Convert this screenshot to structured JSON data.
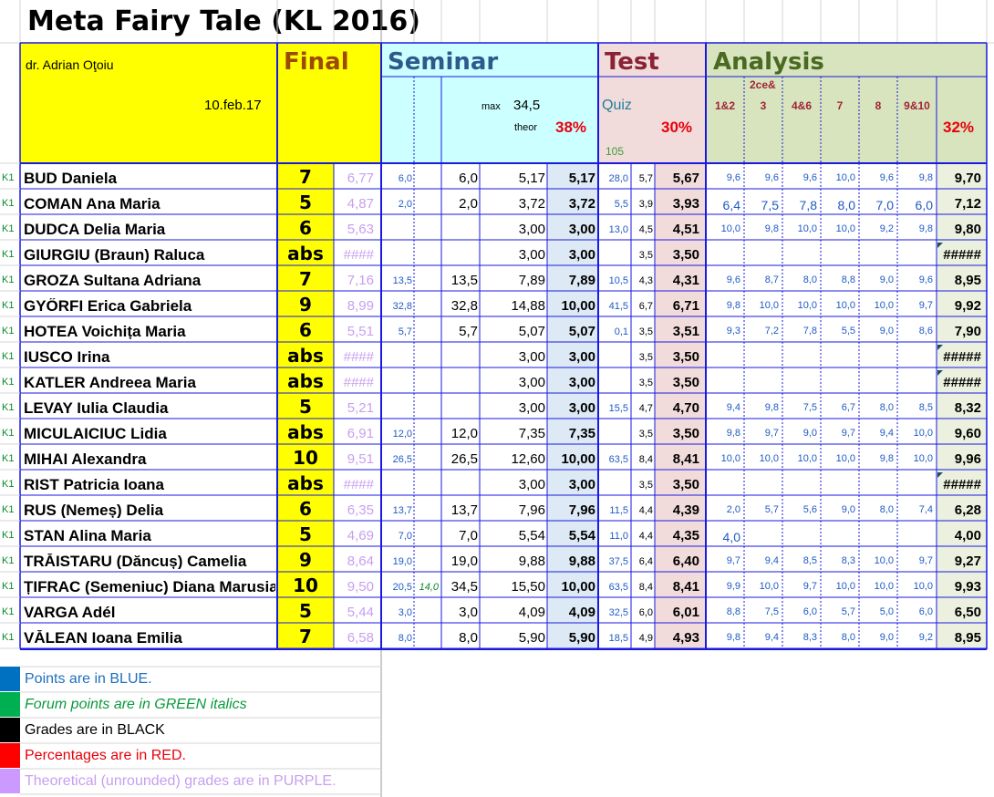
{
  "title": "Meta Fairy Tale (KL 2016)",
  "teacher": "dr. Adrian Oţoiu",
  "date": "10.feb.17",
  "sections": {
    "final": "Final",
    "seminar": "Seminar",
    "test": "Test",
    "analysis": "Analysis"
  },
  "seminar_header": {
    "max_label": "max",
    "max_value": "34,5",
    "theor_label": "theor",
    "percent": "38%"
  },
  "test_header": {
    "label": "Quiz",
    "percent": "30%",
    "forum_count": "105"
  },
  "analysis_header": {
    "cols": [
      "1&2",
      "3",
      "4&6",
      "7",
      "8",
      "9&10"
    ],
    "col2_top": "2ce&",
    "percent": "32%"
  },
  "colors": {
    "yellow": "#ffff00",
    "seminar_bg": "#ccffff",
    "test_bg": "#f2dcdb",
    "analysis_bg": "#d7e4bd",
    "border_blue": "#1a1ae0"
  },
  "rows": [
    {
      "k": "K1",
      "name": "BUD Daniela",
      "final": "7",
      "theor": "6,77",
      "s1": "6,0",
      "s2": "",
      "s3": "6,0",
      "s4": "5,17",
      "sg": "5,17",
      "q1": "28,0",
      "q2": "5,7",
      "qg": "5,67",
      "a": [
        "9,6",
        "9,6",
        "9,6",
        "10,0",
        "9,6",
        "9,8"
      ],
      "ag": "9,70"
    },
    {
      "k": "K1",
      "name": "COMAN Ana Maria",
      "final": "5",
      "theor": "4,87",
      "s1": "2,0",
      "s2": "",
      "s3": "2,0",
      "s4": "3,72",
      "sg": "3,72",
      "q1": "5,5",
      "q2": "3,9",
      "qg": "3,93",
      "a": [
        "6,4",
        "7,5",
        "7,8",
        "8,0",
        "7,0",
        "6,0"
      ],
      "ag": "7,12"
    },
    {
      "k": "K1",
      "name": "DUDCA Delia Maria",
      "final": "6",
      "theor": "5,63",
      "s1": "",
      "s2": "",
      "s3": "",
      "s4": "3,00",
      "sg": "3,00",
      "q1": "13,0",
      "q2": "4,5",
      "qg": "4,51",
      "a": [
        "10,0",
        "9,8",
        "10,0",
        "10,0",
        "9,2",
        "9,8"
      ],
      "ag": "9,80"
    },
    {
      "k": "K1",
      "name": "GIURGIU (Braun) Raluca",
      "final": "abs",
      "theor": "####",
      "s1": "",
      "s2": "",
      "s3": "",
      "s4": "3,00",
      "sg": "3,00",
      "q1": "",
      "q2": "3,5",
      "qg": "3,50",
      "a": [
        "",
        "",
        "",
        "",
        "",
        ""
      ],
      "ag": "#####"
    },
    {
      "k": "K1",
      "name": "GROZA Sultana Adriana",
      "final": "7",
      "theor": "7,16",
      "s1": "13,5",
      "s2": "",
      "s3": "13,5",
      "s4": "7,89",
      "sg": "7,89",
      "q1": "10,5",
      "q2": "4,3",
      "qg": "4,31",
      "a": [
        "9,6",
        "8,7",
        "8,0",
        "8,8",
        "9,0",
        "9,6"
      ],
      "ag": "8,95"
    },
    {
      "k": "K1",
      "name": "GYŐRFI Erica Gabriela",
      "final": "9",
      "theor": "8,99",
      "s1": "32,8",
      "s2": "",
      "s3": "32,8",
      "s4": "14,88",
      "sg": "10,00",
      "q1": "41,5",
      "q2": "6,7",
      "qg": "6,71",
      "a": [
        "9,8",
        "10,0",
        "10,0",
        "10,0",
        "10,0",
        "9,7"
      ],
      "ag": "9,92"
    },
    {
      "k": "K1",
      "name": "HOTEA Voichița Maria",
      "final": "6",
      "theor": "5,51",
      "s1": "5,7",
      "s2": "",
      "s3": "5,7",
      "s4": "5,07",
      "sg": "5,07",
      "q1": "0,1",
      "q2": "3,5",
      "qg": "3,51",
      "a": [
        "9,3",
        "7,2",
        "7,8",
        "5,5",
        "9,0",
        "8,6"
      ],
      "ag": "7,90"
    },
    {
      "k": "K1",
      "name": "IUSCO Irina",
      "final": "abs",
      "theor": "####",
      "s1": "",
      "s2": "",
      "s3": "",
      "s4": "3,00",
      "sg": "3,00",
      "q1": "",
      "q2": "3,5",
      "qg": "3,50",
      "a": [
        "",
        "",
        "",
        "",
        "",
        ""
      ],
      "ag": "#####"
    },
    {
      "k": "K1",
      "name": "KATLER Andreea Maria",
      "final": "abs",
      "theor": "####",
      "s1": "",
      "s2": "",
      "s3": "",
      "s4": "3,00",
      "sg": "3,00",
      "q1": "",
      "q2": "3,5",
      "qg": "3,50",
      "a": [
        "",
        "",
        "",
        "",
        "",
        ""
      ],
      "ag": "#####"
    },
    {
      "k": "K1",
      "name": "LEVAY Iulia Claudia",
      "final": "5",
      "theor": "5,21",
      "s1": "",
      "s2": "",
      "s3": "",
      "s4": "3,00",
      "sg": "3,00",
      "q1": "15,5",
      "q2": "4,7",
      "qg": "4,70",
      "a": [
        "9,4",
        "9,8",
        "7,5",
        "6,7",
        "8,0",
        "8,5"
      ],
      "ag": "8,32"
    },
    {
      "k": "K1",
      "name": "MICULAICIUC Lidia",
      "final": "abs",
      "theor": "6,91",
      "s1": "12,0",
      "s2": "",
      "s3": "12,0",
      "s4": "7,35",
      "sg": "7,35",
      "q1": "",
      "q2": "3,5",
      "qg": "3,50",
      "a": [
        "9,8",
        "9,7",
        "9,0",
        "9,7",
        "9,4",
        "10,0"
      ],
      "ag": "9,60"
    },
    {
      "k": "K1",
      "name": "MIHAI Alexandra",
      "final": "10",
      "theor": "9,51",
      "s1": "26,5",
      "s2": "",
      "s3": "26,5",
      "s4": "12,60",
      "sg": "10,00",
      "q1": "63,5",
      "q2": "8,4",
      "qg": "8,41",
      "a": [
        "10,0",
        "10,0",
        "10,0",
        "10,0",
        "9,8",
        "10,0"
      ],
      "ag": "9,96"
    },
    {
      "k": "K1",
      "name": "RIST Patricia Ioana",
      "final": "abs",
      "theor": "####",
      "s1": "",
      "s2": "",
      "s3": "",
      "s4": "3,00",
      "sg": "3,00",
      "q1": "",
      "q2": "3,5",
      "qg": "3,50",
      "a": [
        "",
        "",
        "",
        "",
        "",
        ""
      ],
      "ag": "#####"
    },
    {
      "k": "K1",
      "name": "RUS (Nemeș) Delia",
      "final": "6",
      "theor": "6,35",
      "s1": "13,7",
      "s2": "",
      "s3": "13,7",
      "s4": "7,96",
      "sg": "7,96",
      "q1": "11,5",
      "q2": "4,4",
      "qg": "4,39",
      "a": [
        "2,0",
        "5,7",
        "5,6",
        "9,0",
        "8,0",
        "7,4"
      ],
      "ag": "6,28"
    },
    {
      "k": "K1",
      "name": "STAN Alina Maria",
      "final": "5",
      "theor": "4,69",
      "s1": "7,0",
      "s2": "",
      "s3": "7,0",
      "s4": "5,54",
      "sg": "5,54",
      "q1": "11,0",
      "q2": "4,4",
      "qg": "4,35",
      "a": [
        "4,0",
        "",
        "",
        "",
        "",
        ""
      ],
      "ag": "4,00"
    },
    {
      "k": "K1",
      "name": "TRĂISTARU (Dăncuș) Camelia",
      "final": "9",
      "theor": "8,64",
      "s1": "19,0",
      "s2": "",
      "s3": "19,0",
      "s4": "9,88",
      "sg": "9,88",
      "q1": "37,5",
      "q2": "6,4",
      "qg": "6,40",
      "a": [
        "9,7",
        "9,4",
        "8,5",
        "8,3",
        "10,0",
        "9,7"
      ],
      "ag": "9,27"
    },
    {
      "k": "K1",
      "name": "ȚIFRAC (Semeniuc) Diana Marusia",
      "final": "10",
      "theor": "9,50",
      "s1": "20,5",
      "s2": "14,0",
      "s3": "34,5",
      "s4": "15,50",
      "sg": "10,00",
      "q1": "63,5",
      "q2": "8,4",
      "qg": "8,41",
      "a": [
        "9,9",
        "10,0",
        "9,7",
        "10,0",
        "10,0",
        "10,0"
      ],
      "ag": "9,93"
    },
    {
      "k": "K1",
      "name": "VARGA Adél",
      "final": "5",
      "theor": "5,44",
      "s1": "3,0",
      "s2": "",
      "s3": "3,0",
      "s4": "4,09",
      "sg": "4,09",
      "q1": "32,5",
      "q2": "6,0",
      "qg": "6,01",
      "a": [
        "8,8",
        "7,5",
        "6,0",
        "5,7",
        "5,0",
        "6,0"
      ],
      "ag": "6,50"
    },
    {
      "k": "K1",
      "name": "VĂLEAN Ioana Emilia",
      "final": "7",
      "theor": "6,58",
      "s1": "8,0",
      "s2": "",
      "s3": "8,0",
      "s4": "5,90",
      "sg": "5,90",
      "q1": "18,5",
      "q2": "4,9",
      "qg": "4,93",
      "a": [
        "9,8",
        "9,4",
        "8,3",
        "8,0",
        "9,0",
        "9,2"
      ],
      "ag": "8,95"
    }
  ],
  "legend": [
    {
      "text": "Points are in BLUE.",
      "color": "#1f6fbf",
      "swatch": "#0070c0",
      "italic": false
    },
    {
      "text": "Forum points are in GREEN italics",
      "color": "#0a9a3a",
      "swatch": "#00b050",
      "italic": true
    },
    {
      "text": "Grades are in BLACK",
      "color": "#000000",
      "swatch": "#000000",
      "italic": false
    },
    {
      "text": "Percentages are in RED.",
      "color": "#e8000b",
      "swatch": "#ff0000",
      "italic": false
    },
    {
      "text": "Theoretical (unrounded) grades are in PURPLE.",
      "color": "#c79ff0",
      "swatch": "#cc99ff",
      "italic": false
    }
  ]
}
